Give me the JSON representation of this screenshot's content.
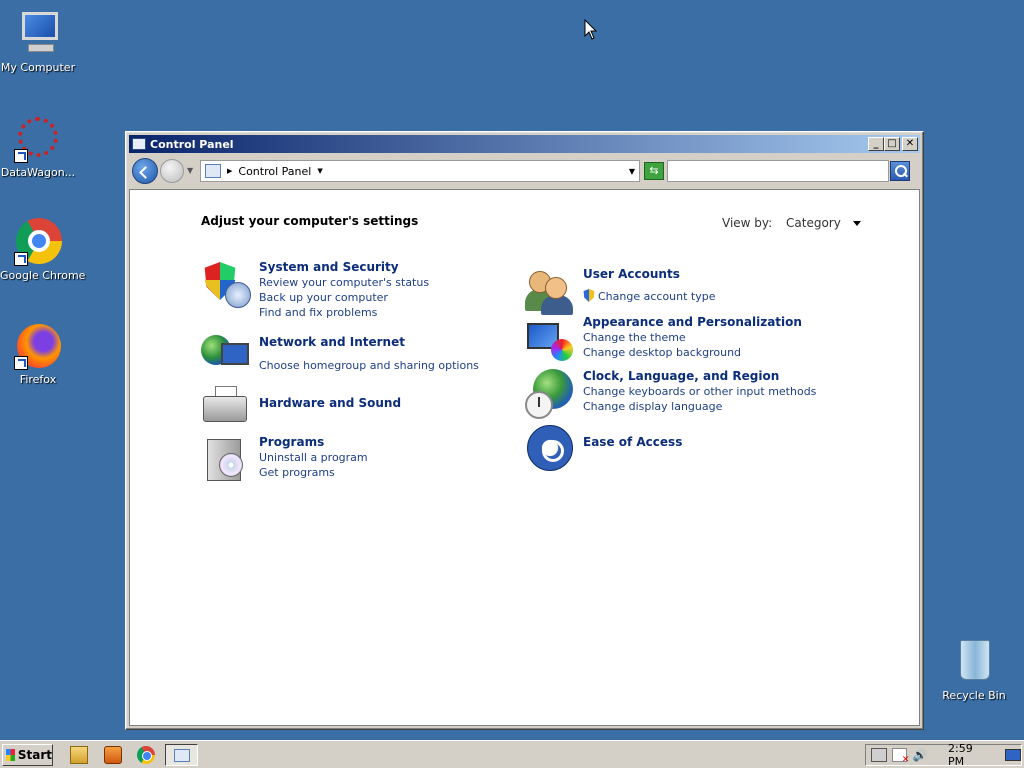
{
  "desktop": {
    "icons": [
      {
        "label": "My Computer",
        "icon": "computer-icon"
      },
      {
        "label": "DataWagon...",
        "icon": "datawagon-icon"
      },
      {
        "label": "Google Chrome",
        "icon": "chrome-icon"
      },
      {
        "label": "Firefox",
        "icon": "firefox-icon"
      },
      {
        "label": "Recycle Bin",
        "icon": "recycle-bin-icon"
      }
    ],
    "background_color": "#3a6ea5"
  },
  "window": {
    "title": "Control Panel",
    "controls": {
      "minimize": "_",
      "maximize": "□",
      "close": "✕"
    },
    "address": {
      "crumb": "Control Panel",
      "search_value": "",
      "search_placeholder": ""
    },
    "heading": "Adjust your computer's settings",
    "view_by": {
      "label": "View by:",
      "value": "Category"
    },
    "categories_left": [
      {
        "title": "System and Security",
        "links": [
          "Review your computer's status",
          "Back up your computer",
          "Find and fix problems"
        ],
        "icon": "shield-icon"
      },
      {
        "title": "Network and Internet",
        "links": [
          "Choose homegroup and sharing options"
        ],
        "icon": "network-icon"
      },
      {
        "title": "Hardware and Sound",
        "links": [],
        "icon": "printer-icon"
      },
      {
        "title": "Programs",
        "links": [
          "Uninstall a program",
          "Get programs"
        ],
        "icon": "programs-icon"
      }
    ],
    "categories_right": [
      {
        "title": "User Accounts",
        "links": [
          "Change account type"
        ],
        "icon": "users-icon"
      },
      {
        "title": "Appearance and Personalization",
        "links": [
          "Change the theme",
          "Change desktop background"
        ],
        "icon": "appearance-icon"
      },
      {
        "title": "Clock, Language, and Region",
        "links": [
          "Change keyboards or other input methods",
          "Change display language"
        ],
        "icon": "clock-globe-icon"
      },
      {
        "title": "Ease of Access",
        "links": [],
        "icon": "ease-of-access-icon"
      }
    ]
  },
  "taskbar": {
    "start_label": "Start",
    "clock": "2:59 PM",
    "quick_launch": [
      "explorer-icon",
      "media-player-icon",
      "chrome-icon"
    ],
    "active_task_icon": "control-panel-icon"
  }
}
